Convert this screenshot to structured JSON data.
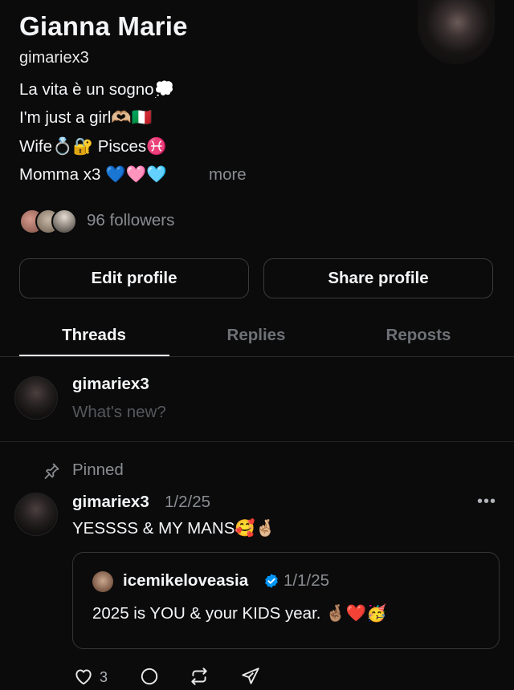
{
  "profile": {
    "name": "Gianna Marie",
    "handle": "gimariex3",
    "bio": [
      "La vita è un sogno💭",
      "I'm just a girl🫶🏼🇮🇹",
      "Wife💍🔐 Pisces♓️",
      "Momma x3 💙🩷🩵"
    ],
    "more_label": "more",
    "followers_label": "96 followers"
  },
  "buttons": {
    "edit_profile": "Edit profile",
    "share_profile": "Share profile"
  },
  "tabs": [
    {
      "label": "Threads",
      "active": true
    },
    {
      "label": "Replies",
      "active": false
    },
    {
      "label": "Reposts",
      "active": false
    }
  ],
  "composer": {
    "username": "gimariex3",
    "placeholder": "What's new?"
  },
  "post": {
    "pinned_label": "Pinned",
    "username": "gimariex3",
    "date": "1/2/25",
    "more_icon": "ellipsis-icon",
    "more_glyph": "•••",
    "text": "YESSSS & MY MANS🥰🤞🏼",
    "quote": {
      "username": "icemikeloveasia",
      "date": "1/1/25",
      "verified": true,
      "text": "2025 is YOU & your KIDS year. 🤞🏽❤️🥳"
    },
    "like_count": "3"
  },
  "colors": {
    "background": "#0b0b0c",
    "text": "#f3f5f7",
    "muted": "#8a8d91",
    "verified_blue": "#0095f6"
  }
}
